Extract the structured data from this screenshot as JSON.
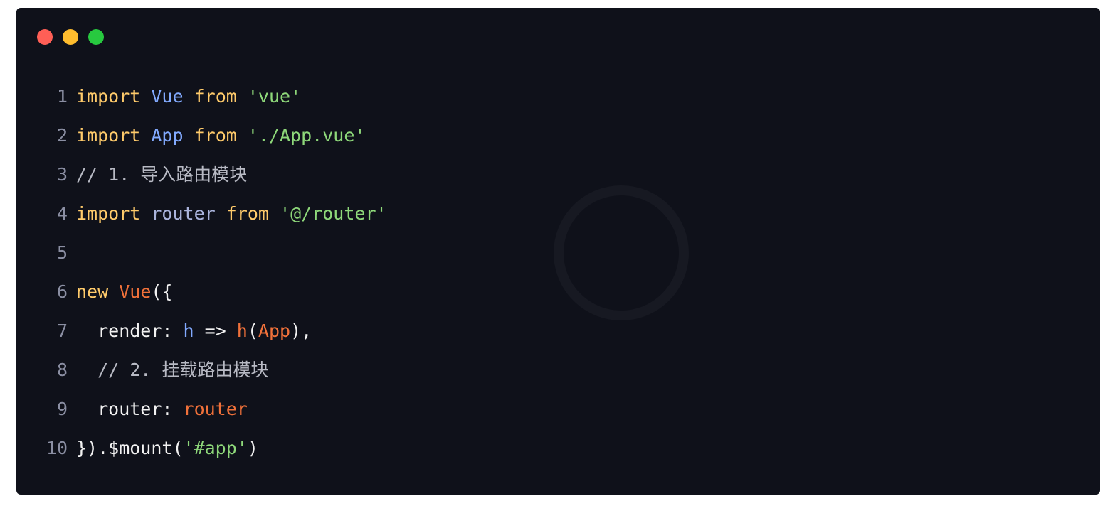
{
  "window_controls": [
    "close",
    "minimize",
    "maximize"
  ],
  "colors": {
    "background": "#0f111a",
    "close": "#ff5f56",
    "minimize": "#ffbd2e",
    "maximize": "#27c93f"
  },
  "lines": [
    {
      "n": "1",
      "tokens": [
        [
          "kw",
          "import"
        ],
        [
          "plain",
          " "
        ],
        [
          "cls",
          "Vue"
        ],
        [
          "plain",
          " "
        ],
        [
          "kw",
          "from"
        ],
        [
          "plain",
          " "
        ],
        [
          "str",
          "'vue'"
        ]
      ]
    },
    {
      "n": "2",
      "tokens": [
        [
          "kw",
          "import"
        ],
        [
          "plain",
          " "
        ],
        [
          "cls",
          "App"
        ],
        [
          "plain",
          " "
        ],
        [
          "kw",
          "from"
        ],
        [
          "plain",
          " "
        ],
        [
          "str",
          "'./App.vue'"
        ]
      ]
    },
    {
      "n": "3",
      "tokens": [
        [
          "cmt",
          "// 1. 导入路由模块"
        ]
      ]
    },
    {
      "n": "4",
      "tokens": [
        [
          "kw",
          "import"
        ],
        [
          "plain",
          " "
        ],
        [
          "ident",
          "router"
        ],
        [
          "plain",
          " "
        ],
        [
          "kw",
          "from"
        ],
        [
          "plain",
          " "
        ],
        [
          "str",
          "'@/router'"
        ]
      ]
    },
    {
      "n": "5",
      "tokens": []
    },
    {
      "n": "6",
      "tokens": [
        [
          "kw",
          "new"
        ],
        [
          "plain",
          " "
        ],
        [
          "fn",
          "Vue"
        ],
        [
          "plain",
          "({"
        ]
      ]
    },
    {
      "n": "7",
      "tokens": [
        [
          "plain",
          "  render: "
        ],
        [
          "var",
          "h"
        ],
        [
          "plain",
          " => "
        ],
        [
          "fn",
          "h"
        ],
        [
          "plain",
          "("
        ],
        [
          "fn",
          "App"
        ],
        [
          "plain",
          "),"
        ]
      ]
    },
    {
      "n": "8",
      "tokens": [
        [
          "cmt",
          "  // 2. 挂载路由模块"
        ]
      ]
    },
    {
      "n": "9",
      "tokens": [
        [
          "plain",
          "  router: "
        ],
        [
          "fn",
          "router"
        ]
      ]
    },
    {
      "n": "10",
      "tokens": [
        [
          "plain",
          "})."
        ],
        [
          "plain",
          "$mount("
        ],
        [
          "str",
          "'#app'"
        ],
        [
          "plain",
          ")"
        ]
      ]
    }
  ]
}
